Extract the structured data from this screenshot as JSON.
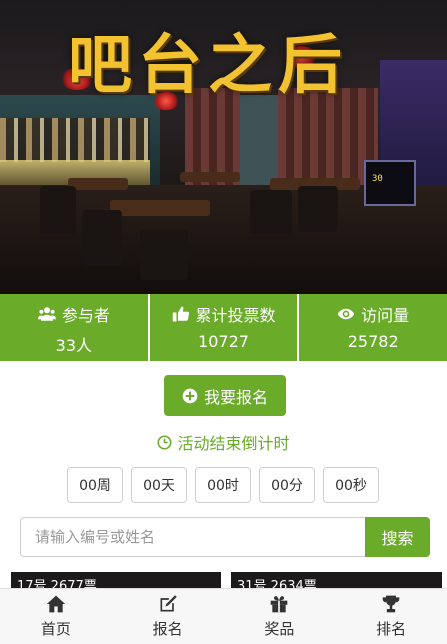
{
  "banner": {
    "title": "吧台之后",
    "board_text": "30"
  },
  "stats": [
    {
      "label": "参与者",
      "value": "33人",
      "icon": "users-icon"
    },
    {
      "label": "累计投票数",
      "value": "10727",
      "icon": "thumbs-up-icon"
    },
    {
      "label": "访问量",
      "value": "25782",
      "icon": "eye-icon"
    }
  ],
  "register": {
    "label": "我要报名",
    "icon": "plus-circle-icon"
  },
  "countdown": {
    "title": "活动结束倒计时",
    "units": [
      "00周",
      "00天",
      "00时",
      "00分",
      "00秒"
    ]
  },
  "search": {
    "placeholder": "请输入编号或姓名",
    "button": "搜索"
  },
  "cards": [
    {
      "label": "17号 2677票"
    },
    {
      "label": "31号 2634票"
    }
  ],
  "nav": [
    {
      "label": "首页",
      "icon": "home-icon"
    },
    {
      "label": "报名",
      "icon": "edit-icon"
    },
    {
      "label": "奖品",
      "icon": "gift-icon"
    },
    {
      "label": "排名",
      "icon": "trophy-icon"
    }
  ],
  "colors": {
    "accent": "#6aab2a",
    "title_gold": "#f2c230"
  }
}
